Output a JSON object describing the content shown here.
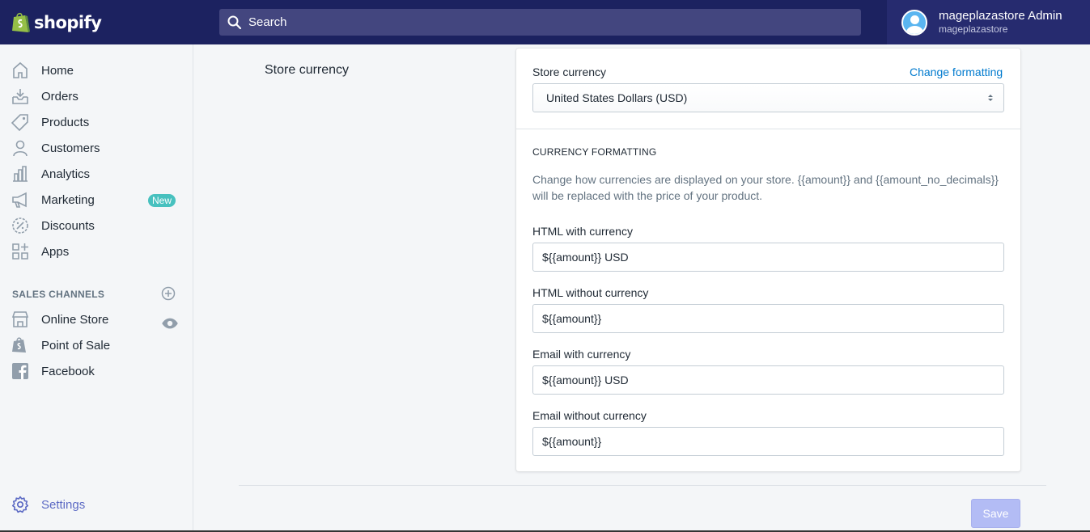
{
  "brand": {
    "name": "shopify"
  },
  "search": {
    "placeholder": "Search"
  },
  "user": {
    "name": "mageplazastore Admin",
    "store": "mageplazastore"
  },
  "sidebar": {
    "items": [
      {
        "label": "Home",
        "icon": "home-icon"
      },
      {
        "label": "Orders",
        "icon": "orders-icon"
      },
      {
        "label": "Products",
        "icon": "tag-icon"
      },
      {
        "label": "Customers",
        "icon": "person-icon"
      },
      {
        "label": "Analytics",
        "icon": "bar-chart-icon"
      },
      {
        "label": "Marketing",
        "icon": "megaphone-icon",
        "badge": "New"
      },
      {
        "label": "Discounts",
        "icon": "discount-icon"
      },
      {
        "label": "Apps",
        "icon": "apps-icon"
      }
    ],
    "sales_channels_title": "SALES CHANNELS",
    "channels": [
      {
        "label": "Online Store",
        "icon": "store-icon"
      },
      {
        "label": "Point of Sale",
        "icon": "shopify-bag-icon"
      },
      {
        "label": "Facebook",
        "icon": "facebook-icon"
      }
    ],
    "settings_label": "Settings"
  },
  "main": {
    "section_title": "Store currency",
    "card": {
      "currency_label": "Store currency",
      "change_formatting": "Change formatting",
      "currency_value": "United States Dollars (USD)",
      "formatting_title": "CURRENCY FORMATTING",
      "formatting_desc": "Change how currencies are displayed on your store. {{amount}} and {{amount_no_decimals}} will be replaced with the price of your product.",
      "fields": [
        {
          "label": "HTML with currency",
          "value": "${{amount}} USD"
        },
        {
          "label": "HTML without currency",
          "value": "${{amount}}"
        },
        {
          "label": "Email with currency",
          "value": "${{amount}} USD"
        },
        {
          "label": "Email without currency",
          "value": "${{amount}}"
        }
      ]
    },
    "save_label": "Save"
  },
  "colors": {
    "topbar": "#1c2260",
    "accent": "#5c6ac4",
    "link": "#007ace",
    "badge": "#47c1bf",
    "save_disabled": "#b3bcf5"
  }
}
